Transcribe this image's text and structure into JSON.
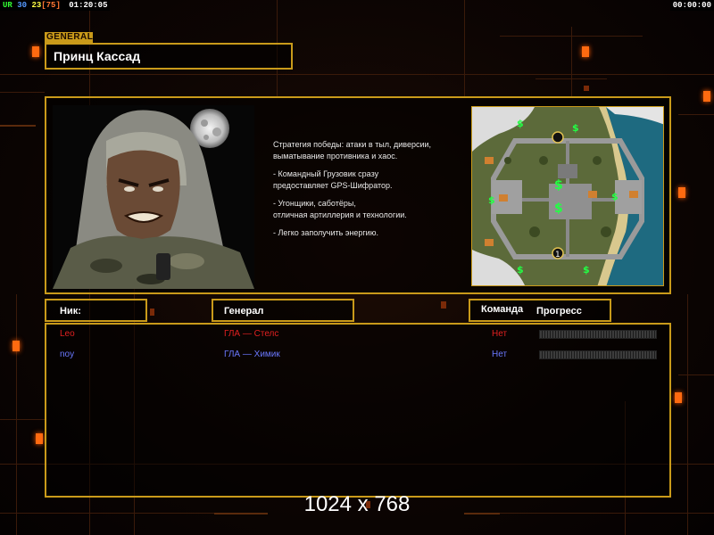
{
  "hud": {
    "ur": "UR",
    "n1": "30",
    "n2": "23",
    "n3": "[75]",
    "time_left": "01:20:05",
    "time_right": "00:00:00"
  },
  "general": {
    "section_label": "GENERAL",
    "name": "Принц Кассад",
    "description": [
      "Стратегия победы: атаки в тыл, диверсии,",
      " выматывание противника и хаос.",
      "- Командный Грузовик сразу",
      "предоставляет GPS-Шифратор.",
      "- Угонщики, саботёры,",
      "отличная артиллерия и технологии.",
      "- Легко заполучить энергию."
    ]
  },
  "table": {
    "headers": {
      "nick": "Ник:",
      "general": "Генерал",
      "team": "Команда",
      "progress": "Прогресс"
    },
    "rows": [
      {
        "nick": "Leo",
        "general": "ГЛА — Стелс",
        "team": "Нет",
        "color": "#e02020",
        "progress": 0
      },
      {
        "nick": "noy",
        "general": "ГЛА — Химик",
        "team": "Нет",
        "color": "#6a78ff",
        "progress": 0
      }
    ]
  },
  "colors": {
    "accent": "#c99a1a",
    "led": "#ff6a10"
  },
  "watermark": "1024 x 768"
}
